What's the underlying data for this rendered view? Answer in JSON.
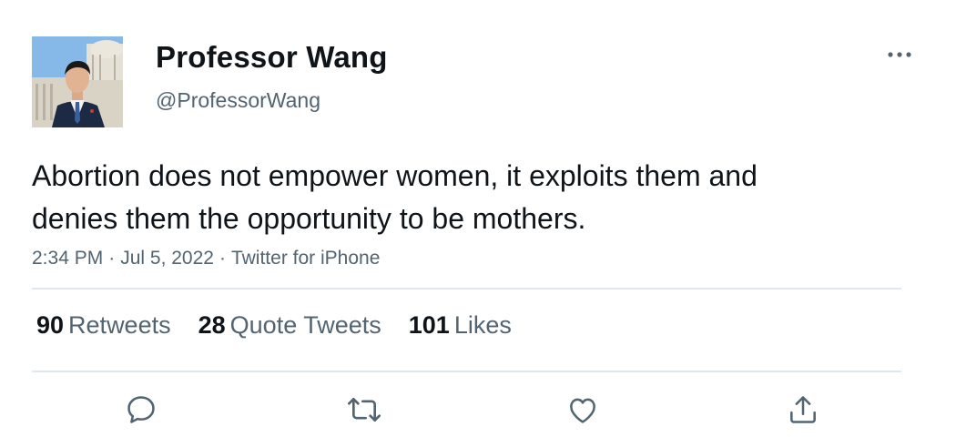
{
  "user": {
    "display_name": "Professor Wang",
    "handle": "@ProfessorWang"
  },
  "tweet": {
    "text_line_1": "Abortion does not empower women, it exploits them and",
    "text_line_2": "denies them the opportunity to be mothers.",
    "time": "2:34 PM",
    "date": "Jul 5, 2022",
    "source": "Twitter for iPhone",
    "separator": "·"
  },
  "stats": {
    "retweets_count": "90",
    "retweets_label": "Retweets",
    "quotes_count": "28",
    "quotes_label": "Quote Tweets",
    "likes_count": "101",
    "likes_label": "Likes"
  },
  "icons": {
    "more": "more-icon",
    "reply": "reply-icon",
    "retweet": "retweet-icon",
    "like": "like-icon",
    "share": "share-icon"
  },
  "colors": {
    "text": "#0f1419",
    "secondary": "#536471",
    "divider": "#e1e8ed"
  }
}
